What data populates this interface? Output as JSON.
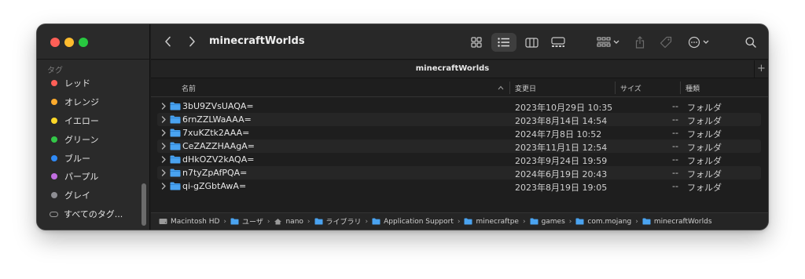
{
  "window": {
    "title": "minecraftWorlds"
  },
  "sidebar": {
    "section_title": "タグ",
    "tags": [
      {
        "label": "レッド",
        "color": "#fe5f57"
      },
      {
        "label": "オレンジ",
        "color": "#fdab2d"
      },
      {
        "label": "イエロー",
        "color": "#fdd728"
      },
      {
        "label": "グリーン",
        "color": "#33c748"
      },
      {
        "label": "ブルー",
        "color": "#2f8af6"
      },
      {
        "label": "パープル",
        "color": "#c16ee0"
      },
      {
        "label": "グレイ",
        "color": "#8e8e93"
      }
    ],
    "all_tags_label": "すべてのタグ..."
  },
  "toolbar": {
    "back_icon": "chevron-left-icon",
    "forward_icon": "chevron-right-icon",
    "view_modes": [
      "icon-view-icon",
      "list-view-icon",
      "column-view-icon",
      "gallery-view-icon"
    ],
    "selected_view": "list-view-icon",
    "group_icon": "group-by-icon",
    "share_icon": "share-icon",
    "tag_icon": "tag-icon",
    "action_icon": "more-actions-icon",
    "search_icon": "search-icon"
  },
  "tabbar": {
    "tab_title": "minecraftWorlds",
    "new_tab_label": "+"
  },
  "columns": {
    "name": "名前",
    "modified": "変更日",
    "size": "サイズ",
    "kind": "種類"
  },
  "files": [
    {
      "name": "3bU9ZVsUAQA=",
      "modified": "2023年10月29日 10:35",
      "size": "--",
      "kind": "フォルダ"
    },
    {
      "name": "6rnZZLWaAAA=",
      "modified": "2023年8月14日 14:54",
      "size": "--",
      "kind": "フォルダ"
    },
    {
      "name": "7xuKZtk2AAA=",
      "modified": "2024年7月8日 10:52",
      "size": "--",
      "kind": "フォルダ"
    },
    {
      "name": "CeZAZZHAAgA=",
      "modified": "2023年11月1日 12:54",
      "size": "--",
      "kind": "フォルダ"
    },
    {
      "name": "dHkOZV2kAQA=",
      "modified": "2023年9月24日 19:59",
      "size": "--",
      "kind": "フォルダ"
    },
    {
      "name": "n7tyZpAfPQA=",
      "modified": "2024年6月19日 20:43",
      "size": "--",
      "kind": "フォルダ"
    },
    {
      "name": "qi-gZGbtAwA=",
      "modified": "2023年8月19日 19:05",
      "size": "--",
      "kind": "フォルダ"
    }
  ],
  "path": [
    {
      "label": "Macintosh HD",
      "icon": "hard-drive-icon"
    },
    {
      "label": "ユーザ",
      "icon": "folder-icon"
    },
    {
      "label": "nano",
      "icon": "home-folder-icon"
    },
    {
      "label": "ライブラリ",
      "icon": "folder-icon"
    },
    {
      "label": "Application Support",
      "icon": "folder-icon"
    },
    {
      "label": "minecraftpe",
      "icon": "folder-icon"
    },
    {
      "label": "games",
      "icon": "folder-icon"
    },
    {
      "label": "com.mojang",
      "icon": "folder-icon"
    },
    {
      "label": "minecraftWorlds",
      "icon": "folder-icon"
    }
  ],
  "colors": {
    "folder": "#4aa3f0",
    "accent": "#2f8af6"
  }
}
